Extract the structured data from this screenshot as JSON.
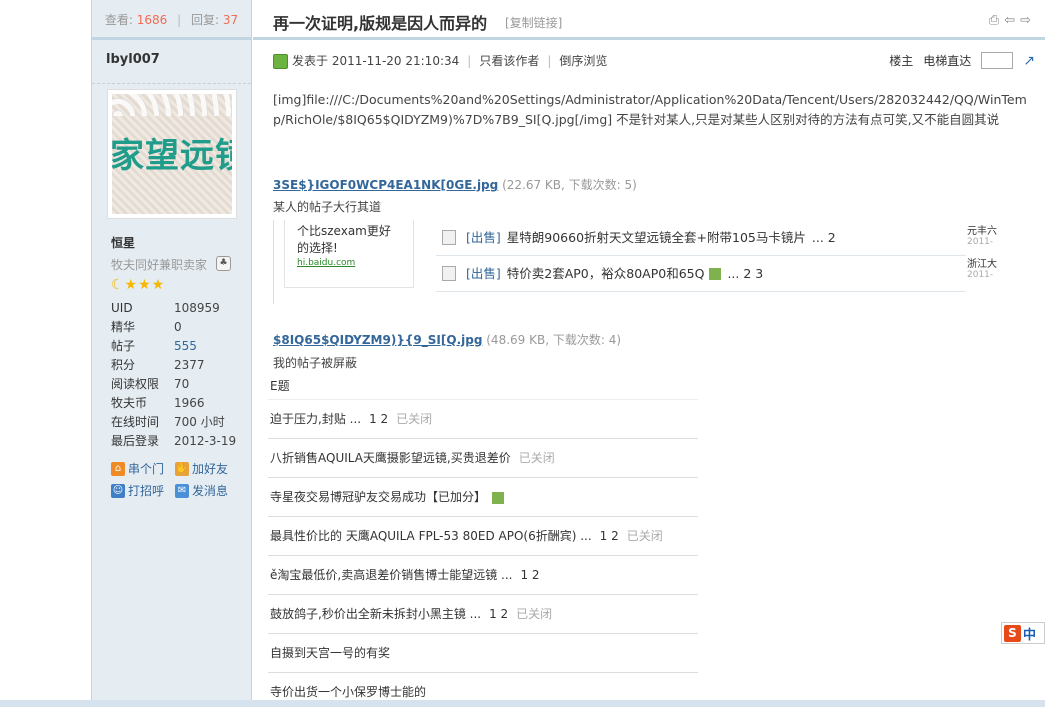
{
  "stats": {
    "views_label": "查看:",
    "views": "1686",
    "replies_label": "回复:",
    "replies": "37"
  },
  "author": {
    "name": "lbyl007",
    "avatar_text": "家望远镜",
    "rank": "恒星",
    "group": "牧夫同好兼职卖家"
  },
  "profile": [
    {
      "k": "UID",
      "v": "108959"
    },
    {
      "k": "精华",
      "v": "0"
    },
    {
      "k": "帖子",
      "v": "555"
    },
    {
      "k": "积分",
      "v": "2377"
    },
    {
      "k": "阅读权限",
      "v": "70"
    },
    {
      "k": "牧夫币",
      "v": "1966"
    },
    {
      "k": "在线时间",
      "v": "700 小时"
    },
    {
      "k": "最后登录",
      "v": "2012-3-19"
    }
  ],
  "actions": [
    {
      "label": "串个门"
    },
    {
      "label": "加好友"
    },
    {
      "label": "打招呼"
    },
    {
      "label": "发消息"
    }
  ],
  "thread": {
    "title": "再一次证明,版规是因人而异的",
    "copy_link": "[复制链接]"
  },
  "post": {
    "posted": "发表于 2011-11-20 21:10:34",
    "only_author": "只看该作者",
    "reverse": "倒序浏览",
    "floor": "楼主",
    "elevator": "电梯直达",
    "body": "[img]file:///C:/Documents%20and%20Settings/Administrator/Application%20Data/Tencent/Users/282032442/QQ/WinTemp/RichOle/$8IQ65$QIDYZM9)%7D%7B9_SI[Q.jpg[/img] 不是针对某人,只是对某些人区别对待的方法有点可笑,又不能自圆其说"
  },
  "attachment1": {
    "name": "3SE$}IGOF0WCP4EA1NK[0GE.jpg",
    "meta": "(22.67 KB, 下载次数: 5)",
    "desc": "某人的帖子大行其道"
  },
  "screenshot1": {
    "ad_line1": "个比szexam更好",
    "ad_line2": "的选择!",
    "ad_url": "hi.baidu.com",
    "items": [
      {
        "tag": "[出售]",
        "text": "星特朗90660折射天文望远镜全套+附带105马卡镜片",
        "pages": "... 2"
      },
      {
        "tag": "[出售]",
        "text": "特价卖2套AP0，裕众80AP0和65Q",
        "pages": "... 2  3"
      }
    ],
    "side": [
      {
        "t": "元丰六",
        "d": "2011-"
      },
      {
        "t": "浙江大",
        "d": "2011-"
      }
    ]
  },
  "attachment2": {
    "name": "$8IQ65$QIDYZM9)}{9_SI[Q.jpg",
    "meta": "(48.69 KB, 下载次数: 4)",
    "desc": "我的帖子被屏蔽"
  },
  "screenshot2": {
    "header": "E题",
    "rows": [
      {
        "t": "迫于压力,封贴 ...",
        "p": "1   2",
        "c": "已关闭"
      },
      {
        "t": "八折销售AQUILA天鹰摄影望远镜,买贵退差价",
        "p": "",
        "c": "已关闭"
      },
      {
        "t": "寺星夜交易博冠驴友交易成功【已加分】",
        "p": "",
        "c": ""
      },
      {
        "t": "最具性价比的 天鹰AQUILA FPL-53 80ED APO(6折酬宾) ...",
        "p": "1   2",
        "c": "已关闭"
      },
      {
        "t": "ě淘宝最低价,卖高退差价销售博士能望远镜 ...",
        "p": "1   2",
        "c": ""
      },
      {
        "t": "鼓放鸽子,秒价出全新未拆封小黑主镜 ...",
        "p": "1   2",
        "c": "已关闭"
      },
      {
        "t": "自摄到天宫一号的有奖",
        "p": "",
        "c": ""
      },
      {
        "t": "寺价出货一个小保罗博士能的",
        "p": "",
        "c": ""
      }
    ]
  },
  "ime": {
    "label": "中"
  }
}
